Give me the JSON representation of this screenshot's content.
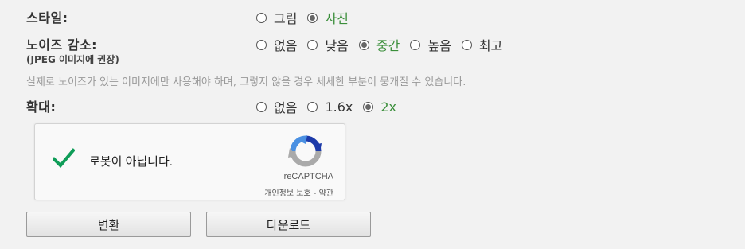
{
  "style_row": {
    "label": "스타일:",
    "options": [
      {
        "label": "그림",
        "selected": false
      },
      {
        "label": "사진",
        "selected": true
      }
    ]
  },
  "noise_row": {
    "label": "노이즈 감소:",
    "sublabel": "(JPEG 이미지에 권장)",
    "options": [
      {
        "label": "없음",
        "selected": false
      },
      {
        "label": "낮음",
        "selected": false
      },
      {
        "label": "중간",
        "selected": true
      },
      {
        "label": "높음",
        "selected": false
      },
      {
        "label": "최고",
        "selected": false
      }
    ]
  },
  "note": "실제로 노이즈가 있는 이미지에만 사용해야 하며, 그렇지 않을 경우 세세한 부분이 뭉개질 수 있습니다.",
  "scale_row": {
    "label": "확대:",
    "options": [
      {
        "label": "없음",
        "selected": false
      },
      {
        "label": "1.6x",
        "selected": false
      },
      {
        "label": "2x",
        "selected": true
      }
    ]
  },
  "captcha": {
    "label": "로봇이 아닙니다.",
    "brand": "reCAPTCHA",
    "links": "개인정보 보호 - 약관",
    "checked": true
  },
  "buttons": {
    "convert": "변환",
    "download": "다운로드"
  },
  "colors": {
    "selected_text": "#3b8f3b",
    "check": "#0f9d58",
    "background": "#f2f2f2"
  }
}
